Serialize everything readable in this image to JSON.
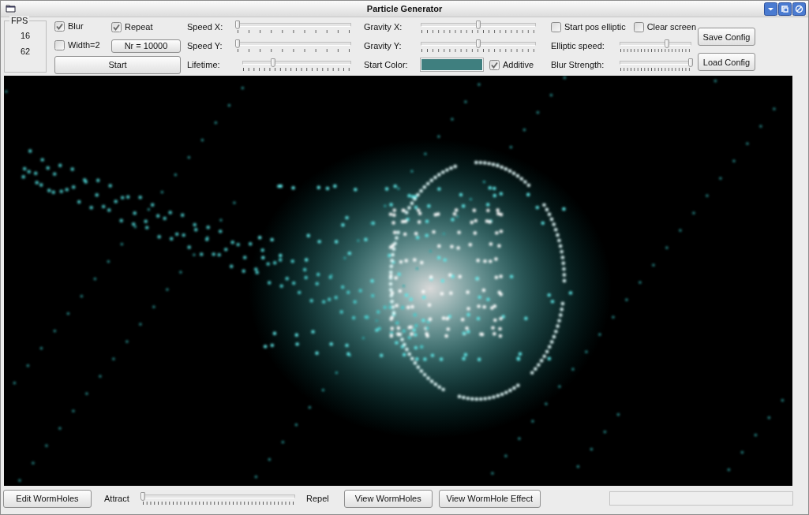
{
  "window": {
    "title": "Particle Generator"
  },
  "fps": {
    "label": "FPS",
    "values": [
      "16",
      "62"
    ]
  },
  "toggles": [
    {
      "label": "Blur",
      "checked": true
    },
    {
      "label": "Repeat",
      "checked": true
    },
    {
      "label": "Width=2",
      "checked": false
    }
  ],
  "count_button": "Nr = 10000",
  "start_button": "Start",
  "speed_sliders": [
    {
      "label": "Speed X:",
      "level": 0
    },
    {
      "label": "Speed Y:",
      "level": 0
    },
    {
      "label": "Lifetime:",
      "level": 0.28
    }
  ],
  "gravity_sliders": [
    {
      "label": "Gravity X:",
      "level": 0.5
    },
    {
      "label": "Gravity Y:",
      "level": 0.5
    }
  ],
  "start_color": {
    "label": "Start Color:",
    "color": "#3f7f7f"
  },
  "additive": {
    "label": "Additive",
    "checked": true
  },
  "elliptic_toggles": [
    {
      "label": "Start pos elliptic",
      "checked": false
    },
    {
      "label": "Clear screen",
      "checked": false
    }
  ],
  "effect_sliders": [
    {
      "label": "Elliptic speed:",
      "level": 0.66
    },
    {
      "label": "Blur Strength:",
      "level": 1
    }
  ],
  "config_buttons": [
    "Save Config",
    "Load Config"
  ],
  "bottom": {
    "edit_button": "Edit WormHoles",
    "attract_label": "Attract",
    "attract_repel_slider": {
      "level": 0
    },
    "repel_label": "Repel",
    "buttons": [
      "View WormHoles",
      "View WormHole Effect"
    ],
    "progress": {
      "level": 0
    }
  }
}
